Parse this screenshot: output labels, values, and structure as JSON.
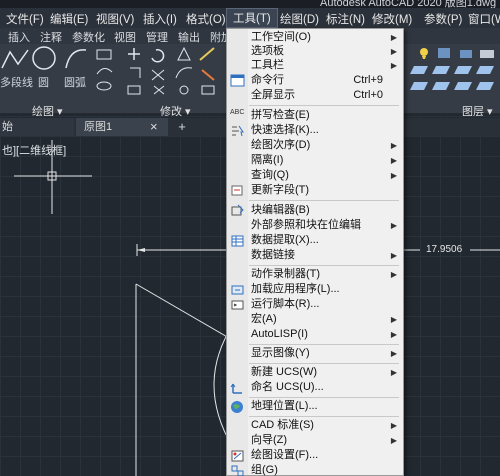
{
  "window": {
    "title": "Autodesk AutoCAD 2020   版图1.dwg"
  },
  "menubar": {
    "items": [
      {
        "label": "文件(F)"
      },
      {
        "label": "编辑(E)"
      },
      {
        "label": "视图(V)"
      },
      {
        "label": "插入(I)"
      },
      {
        "label": "格式(O)"
      },
      {
        "label": "工具(T)"
      },
      {
        "label": "绘图(D)"
      },
      {
        "label": "标注(N)"
      },
      {
        "label": "修改(M)"
      },
      {
        "label": "参数(P)"
      },
      {
        "label": "窗口(W)"
      }
    ]
  },
  "ribbon_tabs": [
    "插入",
    "注释",
    "参数化",
    "视图",
    "管理",
    "输出",
    "附加"
  ],
  "ribbon": {
    "tool_polyline": "多段线",
    "tool_circle": "圆",
    "tool_arc": "圆弧",
    "panel_draw": "绘图 ▾",
    "panel_modify": "修改 ▾",
    "panel_layers": "图层 ▾"
  },
  "doc_tabs": {
    "start": "始",
    "drawing": "原图1",
    "close": "×",
    "add": "+"
  },
  "viewport_label": "也][二维线框]",
  "dimension_text": "17.9506",
  "tools_menu": {
    "items": [
      {
        "label": "工作空间(O)",
        "submenu": true
      },
      {
        "label": "选项板",
        "submenu": true
      },
      {
        "label": "工具栏",
        "submenu": true
      },
      {
        "label": "命令行",
        "shortcut": "Ctrl+9"
      },
      {
        "label": "全屏显示",
        "shortcut": "Ctrl+0"
      },
      {
        "label": "拼写检查(E)"
      },
      {
        "label": "快速选择(K)..."
      },
      {
        "label": "绘图次序(D)",
        "submenu": true
      },
      {
        "label": "隔离(I)",
        "submenu": true
      },
      {
        "label": "查询(Q)",
        "submenu": true
      },
      {
        "label": "更新字段(T)"
      },
      {
        "label": "块编辑器(B)"
      },
      {
        "label": "外部参照和块在位编辑",
        "submenu": true
      },
      {
        "label": "数据提取(X)..."
      },
      {
        "label": "数据链接",
        "submenu": true
      },
      {
        "label": "动作录制器(T)",
        "submenu": true
      },
      {
        "label": "加载应用程序(L)..."
      },
      {
        "label": "运行脚本(R)..."
      },
      {
        "label": "宏(A)",
        "submenu": true
      },
      {
        "label": "AutoLISP(I)",
        "submenu": true
      },
      {
        "label": "显示图像(Y)",
        "submenu": true
      },
      {
        "label": "新建 UCS(W)",
        "submenu": true
      },
      {
        "label": "命名 UCS(U)..."
      },
      {
        "label": "地理位置(L)..."
      },
      {
        "label": "CAD 标准(S)",
        "submenu": true
      },
      {
        "label": "向导(Z)",
        "submenu": true
      },
      {
        "label": "绘图设置(F)..."
      },
      {
        "label": "组(G)"
      }
    ],
    "submenu_arrow": "▶",
    "spell_icon_text": "ABC"
  },
  "colors": {
    "menu_bg": "#f0f0f0",
    "app_bg": "#212830",
    "ribbon_bg": "#353c46"
  }
}
